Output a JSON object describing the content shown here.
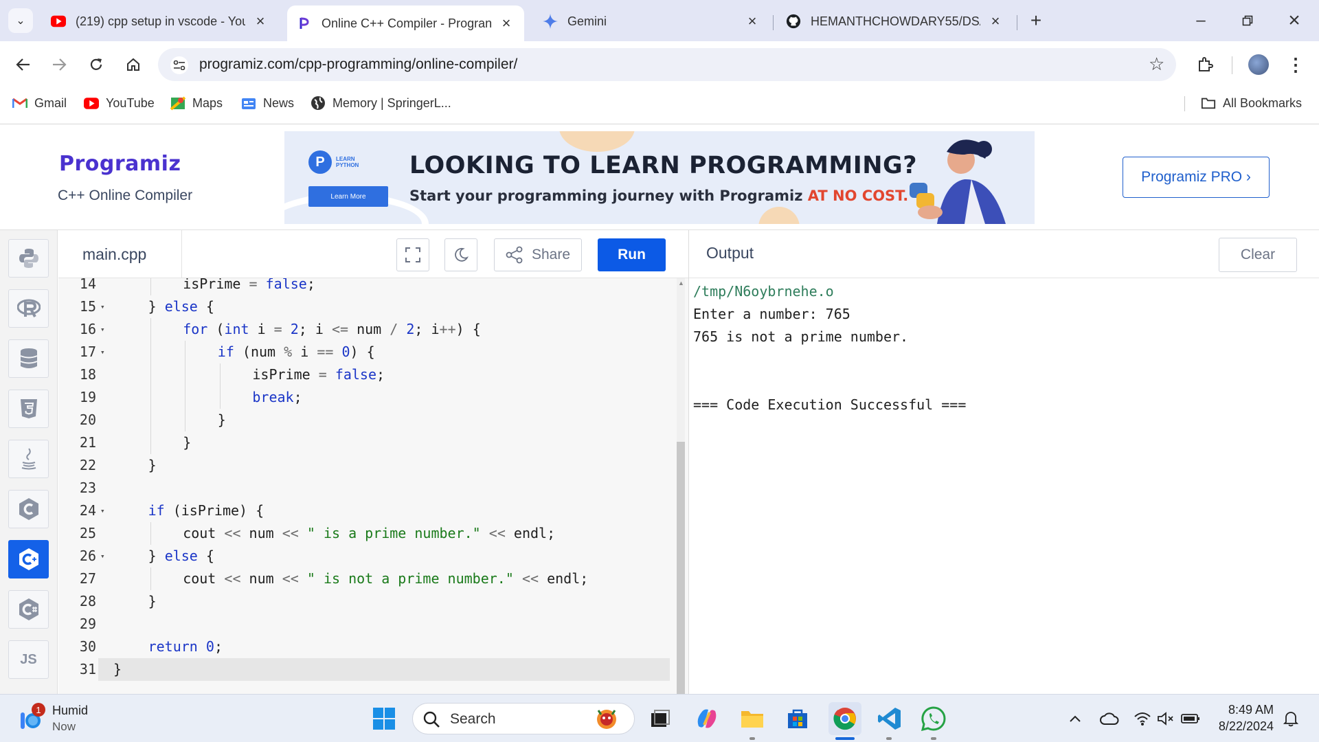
{
  "browser": {
    "tabs": [
      {
        "title": "(219) cpp setup in vscode - You",
        "icon": "youtube-icon",
        "active": false
      },
      {
        "title": "Online C++ Compiler - Progran",
        "icon": "programiz-icon",
        "active": true
      },
      {
        "title": "Gemini",
        "icon": "gemini-icon",
        "active": false
      },
      {
        "title": "HEMANTHCHOWDARY55/DSAC",
        "icon": "github-icon",
        "active": false
      }
    ],
    "url": "programiz.com/cpp-programming/online-compiler/",
    "bookmarks": [
      {
        "label": "Gmail",
        "icon": "gmail-icon"
      },
      {
        "label": "YouTube",
        "icon": "youtube-icon"
      },
      {
        "label": "Maps",
        "icon": "maps-icon"
      },
      {
        "label": "News",
        "icon": "news-icon"
      },
      {
        "label": "Memory | SpringerL...",
        "icon": "globe-icon"
      }
    ],
    "all_bookmarks": "All Bookmarks"
  },
  "header": {
    "logo": "Programiz",
    "subtitle": "C++ Online Compiler",
    "banner": {
      "badge_line1": "LEARN",
      "badge_line2": "PYTHON",
      "learn_more": "Learn More",
      "title": "LOOKING TO LEARN PROGRAMMING?",
      "subtitle_main": "Start your programming journey with Programiz ",
      "subtitle_highlight": "AT NO COST."
    },
    "pro_button": "Programiz PRO ›"
  },
  "languages": [
    "python-icon",
    "r-icon",
    "sql-icon",
    "html-icon",
    "java-icon",
    "c-icon",
    "cpp-icon",
    "csharp-icon",
    "js-icon"
  ],
  "languages_js_label": "JS",
  "editor": {
    "file_name": "main.cpp",
    "share_label": "Share",
    "run_label": "Run",
    "lines": [
      {
        "n": "14",
        "fold": false,
        "indent": 2,
        "tokens": [
          [
            "t",
            "isPrime "
          ],
          [
            "o",
            "= "
          ],
          [
            "k",
            "false"
          ],
          [
            "t",
            ";"
          ]
        ]
      },
      {
        "n": "15",
        "fold": true,
        "indent": 1,
        "tokens": [
          [
            "t",
            "} "
          ],
          [
            "k",
            "else"
          ],
          [
            "t",
            " {"
          ]
        ]
      },
      {
        "n": "16",
        "fold": true,
        "indent": 2,
        "tokens": [
          [
            "k",
            "for"
          ],
          [
            "t",
            " ("
          ],
          [
            "k",
            "int"
          ],
          [
            "t",
            " i "
          ],
          [
            "o",
            "="
          ],
          [
            "t",
            " "
          ],
          [
            "n",
            "2"
          ],
          [
            "t",
            "; i "
          ],
          [
            "o",
            "<="
          ],
          [
            "t",
            " num "
          ],
          [
            "o",
            "/"
          ],
          [
            "t",
            " "
          ],
          [
            "n",
            "2"
          ],
          [
            "t",
            "; i"
          ],
          [
            "o",
            "++"
          ],
          [
            "t",
            ") {"
          ]
        ]
      },
      {
        "n": "17",
        "fold": true,
        "indent": 3,
        "tokens": [
          [
            "k",
            "if"
          ],
          [
            "t",
            " (num "
          ],
          [
            "o",
            "%"
          ],
          [
            "t",
            " i "
          ],
          [
            "o",
            "=="
          ],
          [
            "t",
            " "
          ],
          [
            "n",
            "0"
          ],
          [
            "t",
            ") {"
          ]
        ]
      },
      {
        "n": "18",
        "fold": false,
        "indent": 4,
        "tokens": [
          [
            "t",
            "isPrime "
          ],
          [
            "o",
            "="
          ],
          [
            "t",
            " "
          ],
          [
            "k",
            "false"
          ],
          [
            "t",
            ";"
          ]
        ]
      },
      {
        "n": "19",
        "fold": false,
        "indent": 4,
        "tokens": [
          [
            "k",
            "break"
          ],
          [
            "t",
            ";"
          ]
        ]
      },
      {
        "n": "20",
        "fold": false,
        "indent": 3,
        "tokens": [
          [
            "t",
            "}"
          ]
        ]
      },
      {
        "n": "21",
        "fold": false,
        "indent": 2,
        "tokens": [
          [
            "t",
            "}"
          ]
        ]
      },
      {
        "n": "22",
        "fold": false,
        "indent": 1,
        "tokens": [
          [
            "t",
            "}"
          ]
        ]
      },
      {
        "n": "23",
        "fold": false,
        "indent": 0,
        "tokens": []
      },
      {
        "n": "24",
        "fold": true,
        "indent": 1,
        "tokens": [
          [
            "k",
            "if"
          ],
          [
            "t",
            " (isPrime) {"
          ]
        ]
      },
      {
        "n": "25",
        "fold": false,
        "indent": 2,
        "tokens": [
          [
            "t",
            "cout "
          ],
          [
            "o",
            "<<"
          ],
          [
            "t",
            " num "
          ],
          [
            "o",
            "<<"
          ],
          [
            "t",
            " "
          ],
          [
            "s",
            "\" is a prime number.\""
          ],
          [
            "t",
            " "
          ],
          [
            "o",
            "<<"
          ],
          [
            "t",
            " endl;"
          ]
        ]
      },
      {
        "n": "26",
        "fold": true,
        "indent": 1,
        "tokens": [
          [
            "t",
            "} "
          ],
          [
            "k",
            "else"
          ],
          [
            "t",
            " {"
          ]
        ]
      },
      {
        "n": "27",
        "fold": false,
        "indent": 2,
        "tokens": [
          [
            "t",
            "cout "
          ],
          [
            "o",
            "<<"
          ],
          [
            "t",
            " num "
          ],
          [
            "o",
            "<<"
          ],
          [
            "t",
            " "
          ],
          [
            "s",
            "\" is not a prime number.\""
          ],
          [
            "t",
            " "
          ],
          [
            "o",
            "<<"
          ],
          [
            "t",
            " endl;"
          ]
        ]
      },
      {
        "n": "28",
        "fold": false,
        "indent": 1,
        "tokens": [
          [
            "t",
            "}"
          ]
        ]
      },
      {
        "n": "29",
        "fold": false,
        "indent": 0,
        "tokens": []
      },
      {
        "n": "30",
        "fold": false,
        "indent": 1,
        "tokens": [
          [
            "k",
            "return"
          ],
          [
            "t",
            " "
          ],
          [
            "n",
            "0"
          ],
          [
            "t",
            ";"
          ]
        ]
      },
      {
        "n": "31",
        "fold": false,
        "indent": 0,
        "tokens": [
          [
            "t",
            "}"
          ]
        ],
        "current": true
      }
    ]
  },
  "output": {
    "title": "Output",
    "clear_label": "Clear",
    "lines": [
      {
        "text": "/tmp/N6oybrnehe.o",
        "kind": "path"
      },
      {
        "text": "Enter a number: 765",
        "kind": "normal"
      },
      {
        "text": "765 is not a prime number.",
        "kind": "normal"
      },
      {
        "text": "",
        "kind": "normal"
      },
      {
        "text": "",
        "kind": "normal"
      },
      {
        "text": "=== Code Execution Successful ===",
        "kind": "normal"
      }
    ]
  },
  "taskbar": {
    "weather_badge": "1",
    "weather_title": "Humid",
    "weather_sub": "Now",
    "search_label": "Search",
    "time": "8:49 AM",
    "date": "8/22/2024"
  },
  "colors": {
    "accent": "#0c5ae6",
    "logo": "#4a32cf",
    "keyword": "#1a35c7",
    "string": "#1a7a1a"
  }
}
